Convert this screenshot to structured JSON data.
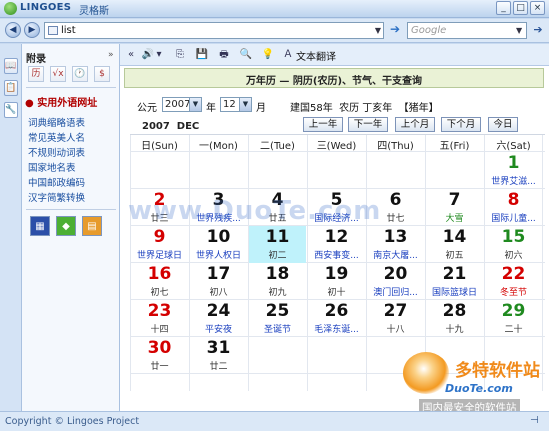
{
  "titlebar": {
    "brand": "LINGOES",
    "brand_cn": "灵格斯",
    "min": "_",
    "max": "□",
    "close": "×"
  },
  "toolbar": {
    "back": "◀",
    "forward": "▶",
    "address_value": "list",
    "address_dropdown": "▼",
    "go": "➔",
    "search_placeholder": "Google",
    "search_dropdown": "▼",
    "search_go": "➔"
  },
  "iconstrip": [
    "📖",
    "📋",
    "🔧"
  ],
  "left_panel": {
    "title": "附录",
    "close": "»",
    "tool_icons": [
      "历",
      "√x",
      "🕐",
      "$"
    ],
    "active_item": "● 实用外语网址",
    "links": [
      "词典缩略语表",
      "常见英美人名",
      "不规则动词表",
      "国家地名表",
      "中国邮政编码",
      "汉字简繁转换"
    ],
    "app_icons": [
      "▦",
      "◆",
      "▤"
    ]
  },
  "main_toolbar": {
    "collapse": "«",
    "speaker": "🔊",
    "speaker_drop": "▾",
    "copy": "⎘",
    "save": "💾",
    "print": "🖶",
    "find": "🔍",
    "tip": "💡",
    "translate_icon": "Ａ",
    "translate_label": "文本翻译"
  },
  "calendar": {
    "header": "万年历 — 阴历(农历)、节气、干支查询",
    "year_prefix": "公元",
    "year": "2007",
    "year_suffix": "年",
    "month": "12",
    "month_suffix": "月",
    "info": "建国58年  农历 丁亥年  【猪年】",
    "current_label": "2007  DEC",
    "buttons": [
      "上一年",
      "下一年",
      "上个月",
      "下个月",
      "今日"
    ],
    "weekdays": [
      "日(Sun)",
      "一(Mon)",
      "二(Tue)",
      "三(Wed)",
      "四(Thu)",
      "五(Fri)",
      "六(Sat)"
    ],
    "today": "11",
    "colors": {
      "weekend": "#d40000",
      "saturday": "#1f8a1f",
      "weekday": "#111111",
      "festival": "#1a3fbf",
      "term": "#1f8a1f",
      "highlight": "#bff2fb"
    },
    "weeks": [
      [
        null,
        null,
        null,
        null,
        null,
        null,
        {
          "d": "1",
          "s": "世界艾滋...",
          "c": "sat",
          "sc": "festival"
        }
      ],
      [
        {
          "d": "2",
          "s": "廿三",
          "c": "sun",
          "sc": "plain"
        },
        {
          "d": "3",
          "s": "世界残疾...",
          "c": "wk",
          "sc": "festival"
        },
        {
          "d": "4",
          "s": "廿五",
          "c": "wk",
          "sc": "plain"
        },
        {
          "d": "5",
          "s": "国际经济...",
          "c": "wk",
          "sc": "festival"
        },
        {
          "d": "6",
          "s": "廿七",
          "c": "wk",
          "sc": "plain"
        },
        {
          "d": "7",
          "s": "大雪",
          "c": "wk",
          "sc": "term"
        },
        {
          "d": "8",
          "s": "国际儿童...",
          "c": "sun",
          "sc": "festival"
        }
      ],
      [
        {
          "d": "9",
          "s": "世界足球日",
          "c": "sun",
          "sc": "festival"
        },
        {
          "d": "10",
          "s": "世界人权日",
          "c": "wk",
          "sc": "festival"
        },
        {
          "d": "11",
          "s": "初二",
          "c": "wk",
          "sc": "plain"
        },
        {
          "d": "12",
          "s": "西安事变...",
          "c": "wk",
          "sc": "festival"
        },
        {
          "d": "13",
          "s": "南京大屠...",
          "c": "wk",
          "sc": "festival"
        },
        {
          "d": "14",
          "s": "初五",
          "c": "wk",
          "sc": "plain"
        },
        {
          "d": "15",
          "s": "初六",
          "c": "sat",
          "sc": "plain"
        }
      ],
      [
        {
          "d": "16",
          "s": "初七",
          "c": "sun",
          "sc": "plain"
        },
        {
          "d": "17",
          "s": "初八",
          "c": "wk",
          "sc": "plain"
        },
        {
          "d": "18",
          "s": "初九",
          "c": "wk",
          "sc": "plain"
        },
        {
          "d": "19",
          "s": "初十",
          "c": "wk",
          "sc": "plain"
        },
        {
          "d": "20",
          "s": "澳门回归...",
          "c": "wk",
          "sc": "festival"
        },
        {
          "d": "21",
          "s": "国际篮球日",
          "c": "wk",
          "sc": "festival"
        },
        {
          "d": "22",
          "s": "冬至节",
          "c": "sun",
          "sc": "red"
        }
      ],
      [
        {
          "d": "23",
          "s": "十四",
          "c": "sun",
          "sc": "plain"
        },
        {
          "d": "24",
          "s": "平安夜",
          "c": "wk",
          "sc": "festival"
        },
        {
          "d": "25",
          "s": "圣诞节",
          "c": "wk",
          "sc": "festival"
        },
        {
          "d": "26",
          "s": "毛泽东诞...",
          "c": "wk",
          "sc": "festival"
        },
        {
          "d": "27",
          "s": "十八",
          "c": "wk",
          "sc": "plain"
        },
        {
          "d": "28",
          "s": "十九",
          "c": "wk",
          "sc": "plain"
        },
        {
          "d": "29",
          "s": "二十",
          "c": "sat",
          "sc": "plain"
        }
      ],
      [
        {
          "d": "30",
          "s": "廿一",
          "c": "sun",
          "sc": "plain"
        },
        {
          "d": "31",
          "s": "廿二",
          "c": "wk",
          "sc": "plain"
        },
        null,
        null,
        null,
        null,
        null
      ]
    ]
  },
  "status": {
    "copyright": "Copyright © Lingoes Project",
    "pin": "⊣"
  },
  "watermark": {
    "center": "www.DuoTe.com",
    "brand": "多特软件站",
    "brand_sub": "DuoTe.com",
    "tagline": "国内最安全的软件站"
  }
}
